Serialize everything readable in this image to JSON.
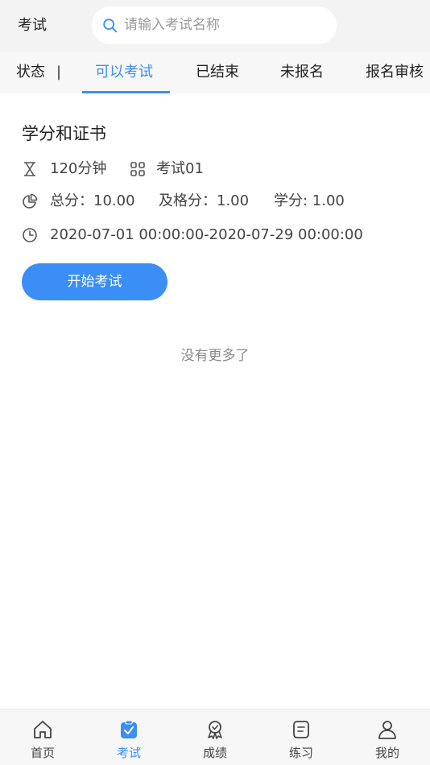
{
  "header": {
    "title": "考试",
    "search_placeholder": "请输入考试名称"
  },
  "tabs": {
    "status_label": "状态",
    "items": [
      {
        "label": "可以考试",
        "active": true
      },
      {
        "label": "已结束",
        "active": false
      },
      {
        "label": "未报名",
        "active": false
      },
      {
        "label": "报名审核",
        "active": false
      }
    ]
  },
  "exam": {
    "title": "学分和证书",
    "duration": "120分钟",
    "paper": "考试01",
    "total_score": "总分：10.00",
    "pass_score": "及格分：1.00",
    "credit": "学分: 1.00",
    "time_range": "2020-07-01 00:00:00-2020-07-29 00:00:00",
    "start_button": "开始考试"
  },
  "list": {
    "no_more_text": "没有更多了"
  },
  "bottom_nav": {
    "items": [
      {
        "label": "首页",
        "icon": "home-icon",
        "active": false
      },
      {
        "label": "考试",
        "icon": "exam-icon",
        "active": true
      },
      {
        "label": "成绩",
        "icon": "award-icon",
        "active": false
      },
      {
        "label": "练习",
        "icon": "practice-icon",
        "active": false
      },
      {
        "label": "我的",
        "icon": "user-icon",
        "active": false
      }
    ]
  },
  "colors": {
    "accent": "#3a8ef6",
    "header_bg": "#f3f3f3",
    "text": "#333333"
  }
}
